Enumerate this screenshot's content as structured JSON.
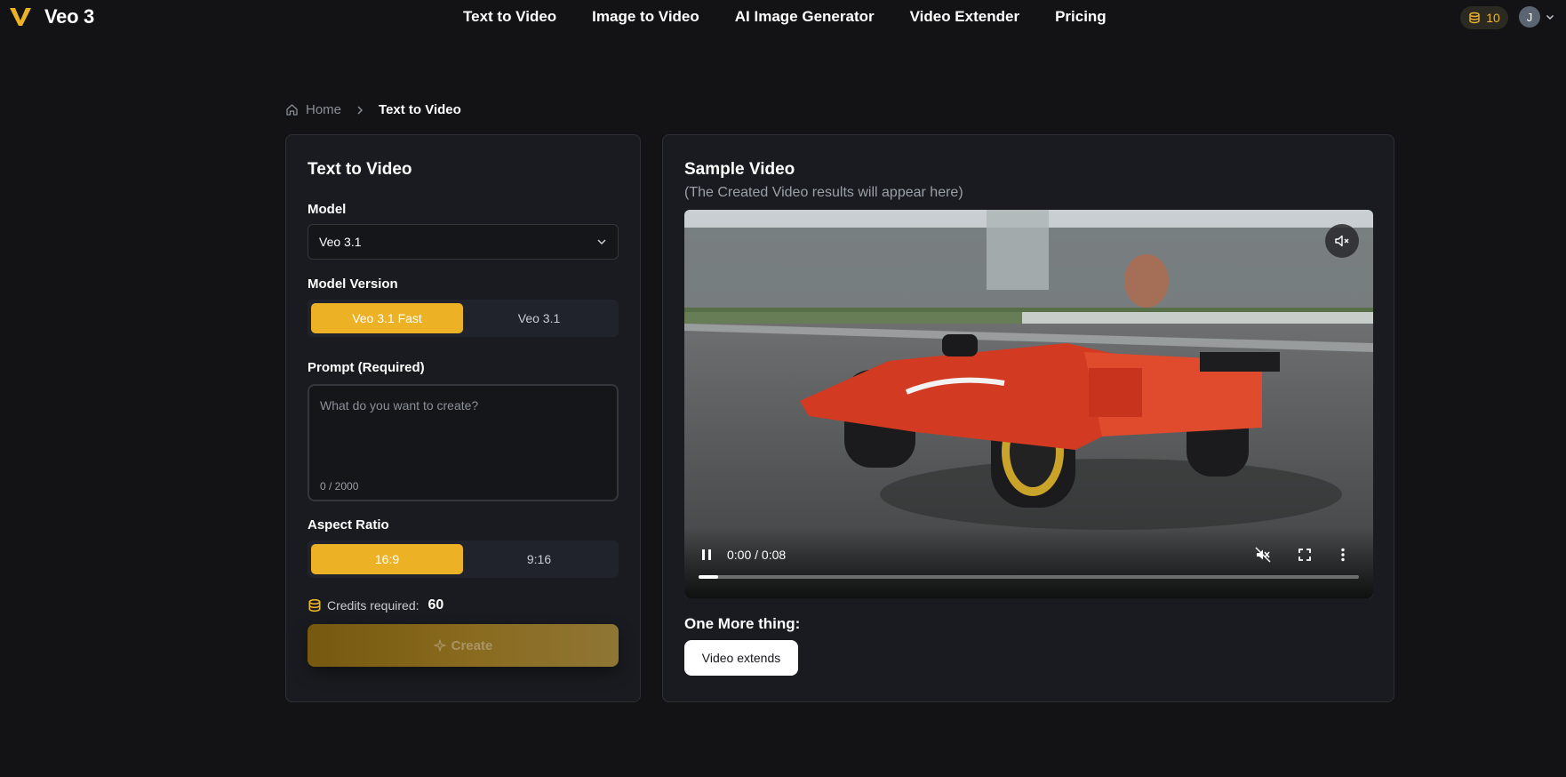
{
  "brand": {
    "name": "Veo 3",
    "accent": "#ecb124"
  },
  "nav": {
    "items": [
      {
        "label": "Text to Video"
      },
      {
        "label": "Image to Video"
      },
      {
        "label": "AI Image Generator"
      },
      {
        "label": "Video Extender"
      },
      {
        "label": "Pricing"
      }
    ]
  },
  "account": {
    "credits": "10",
    "avatar_initial": "J"
  },
  "breadcrumb": {
    "home": "Home",
    "current": "Text to Video"
  },
  "form": {
    "title": "Text to Video",
    "model_label": "Model",
    "model_value": "Veo 3.1",
    "version_label": "Model Version",
    "versions": [
      {
        "label": "Veo 3.1 Fast",
        "active": true
      },
      {
        "label": "Veo 3.1",
        "active": false
      }
    ],
    "prompt_label": "Prompt (Required)",
    "prompt_placeholder": "What do you want to create?",
    "prompt_value": "",
    "prompt_counter": "0 / 2000",
    "aspect_label": "Aspect Ratio",
    "aspects": [
      {
        "label": "16:9",
        "active": true
      },
      {
        "label": "9:16",
        "active": false
      }
    ],
    "credits_label": "Credits required:",
    "credits_value": "60",
    "create_label": "Create"
  },
  "sample": {
    "title": "Sample Video",
    "subtitle": "(The Created Video results will appear here)",
    "time": "0:00 / 0:08",
    "progress": 0.03,
    "more_title": "One More thing:",
    "extend_label": "Video extends"
  }
}
